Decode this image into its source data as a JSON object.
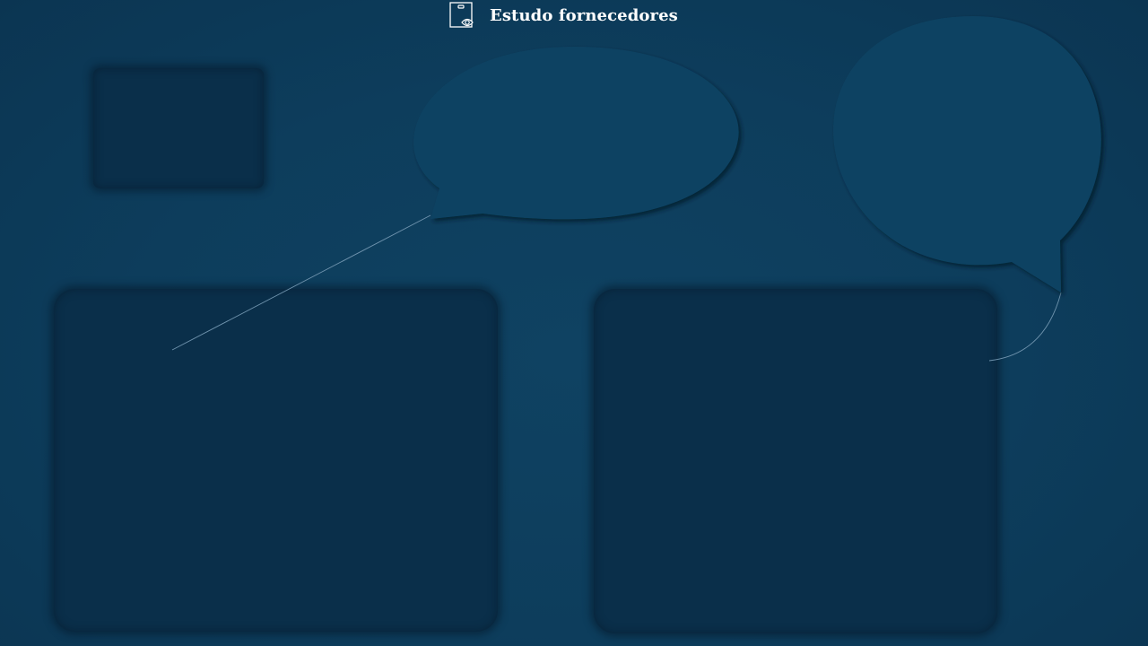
{
  "header": {
    "title": "Estudo fornecedores",
    "icon": "supplier-review-icon"
  },
  "colors": {
    "background": "#0d3d5c",
    "panel": "#0a2f4a",
    "bubble": "#0e4262",
    "connector": "#6f93ad",
    "title_text": "#ffffff"
  }
}
